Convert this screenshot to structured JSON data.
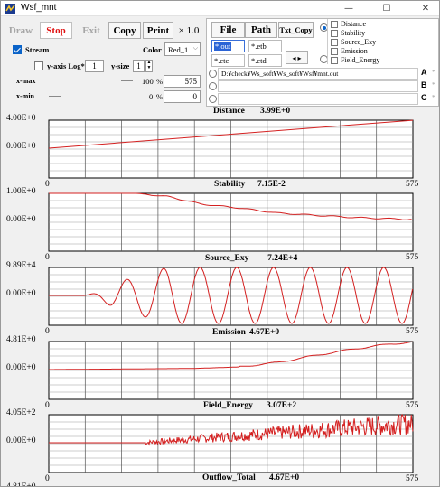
{
  "window": {
    "title": "Wsf_mnt",
    "minimize": "—",
    "maximize": "☐",
    "close": "✕"
  },
  "toolbar": {
    "draw": "Draw",
    "stop": "Stop",
    "exit": "Exit",
    "copy": "Copy",
    "print": "Print",
    "scale": "× 1.0",
    "stream_label": "Stream",
    "stream_checked": true,
    "color_label": "Color",
    "color_value": "Red_1",
    "ylog_label": "y-axis Log*",
    "ylog_value": "1",
    "ysize_label": "y-size",
    "ysize_value": "1",
    "xmax_label": "x-max",
    "xmax_percent": "100",
    "xmax_value": "575",
    "xmin_label": "x-min",
    "xmin_percent": "0",
    "xmin_value": "0",
    "percent_unit": "%"
  },
  "files": {
    "file_btn": "File",
    "path_btn": "Path",
    "txtcopy_btn": "Txt_Copy",
    "ext_out": "*.out",
    "ext_etb": "*.etb",
    "ext_etc": "*.etc",
    "ext_etd": "*.etd",
    "nav": "◂ ▸",
    "paths": [
      {
        "text": "D:¥check¥Ws_soft¥Ws_soft¥Wsf¥mnt.out",
        "letter": "A"
      },
      {
        "text": "",
        "letter": "B"
      },
      {
        "text": "",
        "letter": "C"
      }
    ],
    "star": "*"
  },
  "signals": [
    "Distance",
    "Stability",
    "Source_Exy",
    "Emission",
    "Field_Energy"
  ],
  "chart_data": [
    {
      "type": "line",
      "title": "Distance",
      "value": "3.99E+0",
      "ytop": "4.00E+0",
      "ybottom": "0.00E+0",
      "xmin": "0",
      "xmax": "575",
      "color": "#d42020",
      "series": [
        {
          "x": [
            0,
            575
          ],
          "y": [
            0,
            3.99
          ]
        }
      ]
    },
    {
      "type": "line",
      "title": "Stability",
      "value": "7.15E-2",
      "ytop": "1.00E+0",
      "ybottom": "0.00E+0",
      "xmin": "0",
      "xmax": "575",
      "color": "#d42020",
      "series": [
        {
          "x": [
            0,
            140,
            190,
            240,
            300,
            360,
            420,
            480,
            530,
            575
          ],
          "y": [
            1.0,
            1.0,
            0.88,
            0.62,
            0.48,
            0.3,
            0.22,
            0.14,
            0.1,
            0.07
          ]
        }
      ]
    },
    {
      "type": "line",
      "title": "Source_Exy",
      "value": "-7.24E+4",
      "ytop": "9.89E+4",
      "ybottom": "0.00E+0",
      "xmin": "0",
      "xmax": "575",
      "color": "#d42020",
      "series": [
        {
          "x": [
            0,
            60,
            90,
            575
          ],
          "y": [
            0,
            0,
            0.15,
            0.95
          ],
          "note": "sinusoidal oscillation starting near x=60, amplitude growing to ~9.89E+4"
        }
      ]
    },
    {
      "type": "line",
      "title": "Emission",
      "value": "4.67E+0",
      "ytop": "4.81E+0",
      "ybottom": "0.00E+0",
      "xmin": "0",
      "xmax": "575",
      "color": "#d42020",
      "series": [
        {
          "x": [
            0,
            230,
            300,
            360,
            420,
            480,
            540,
            575
          ],
          "y": [
            0,
            0.2,
            0.45,
            1.2,
            2.4,
            3.5,
            4.4,
            4.67
          ]
        }
      ]
    },
    {
      "type": "line",
      "title": "Field_Energy",
      "value": "3.07E+2",
      "ytop": "4.05E+2",
      "ybottom": "0.00E+0",
      "xmin": "0",
      "xmax": "575",
      "color": "#d42020",
      "series": [
        {
          "x": [
            0,
            150,
            200,
            300,
            400,
            575
          ],
          "y": [
            0,
            0,
            60,
            110,
            190,
            307
          ]
        }
      ]
    },
    {
      "type": "line",
      "title": "Outflow_Total",
      "value": "4.67E+0",
      "ytop": "4.81E+0",
      "xmin": "0",
      "xmax": "575",
      "color": "#d42020",
      "series": []
    }
  ]
}
